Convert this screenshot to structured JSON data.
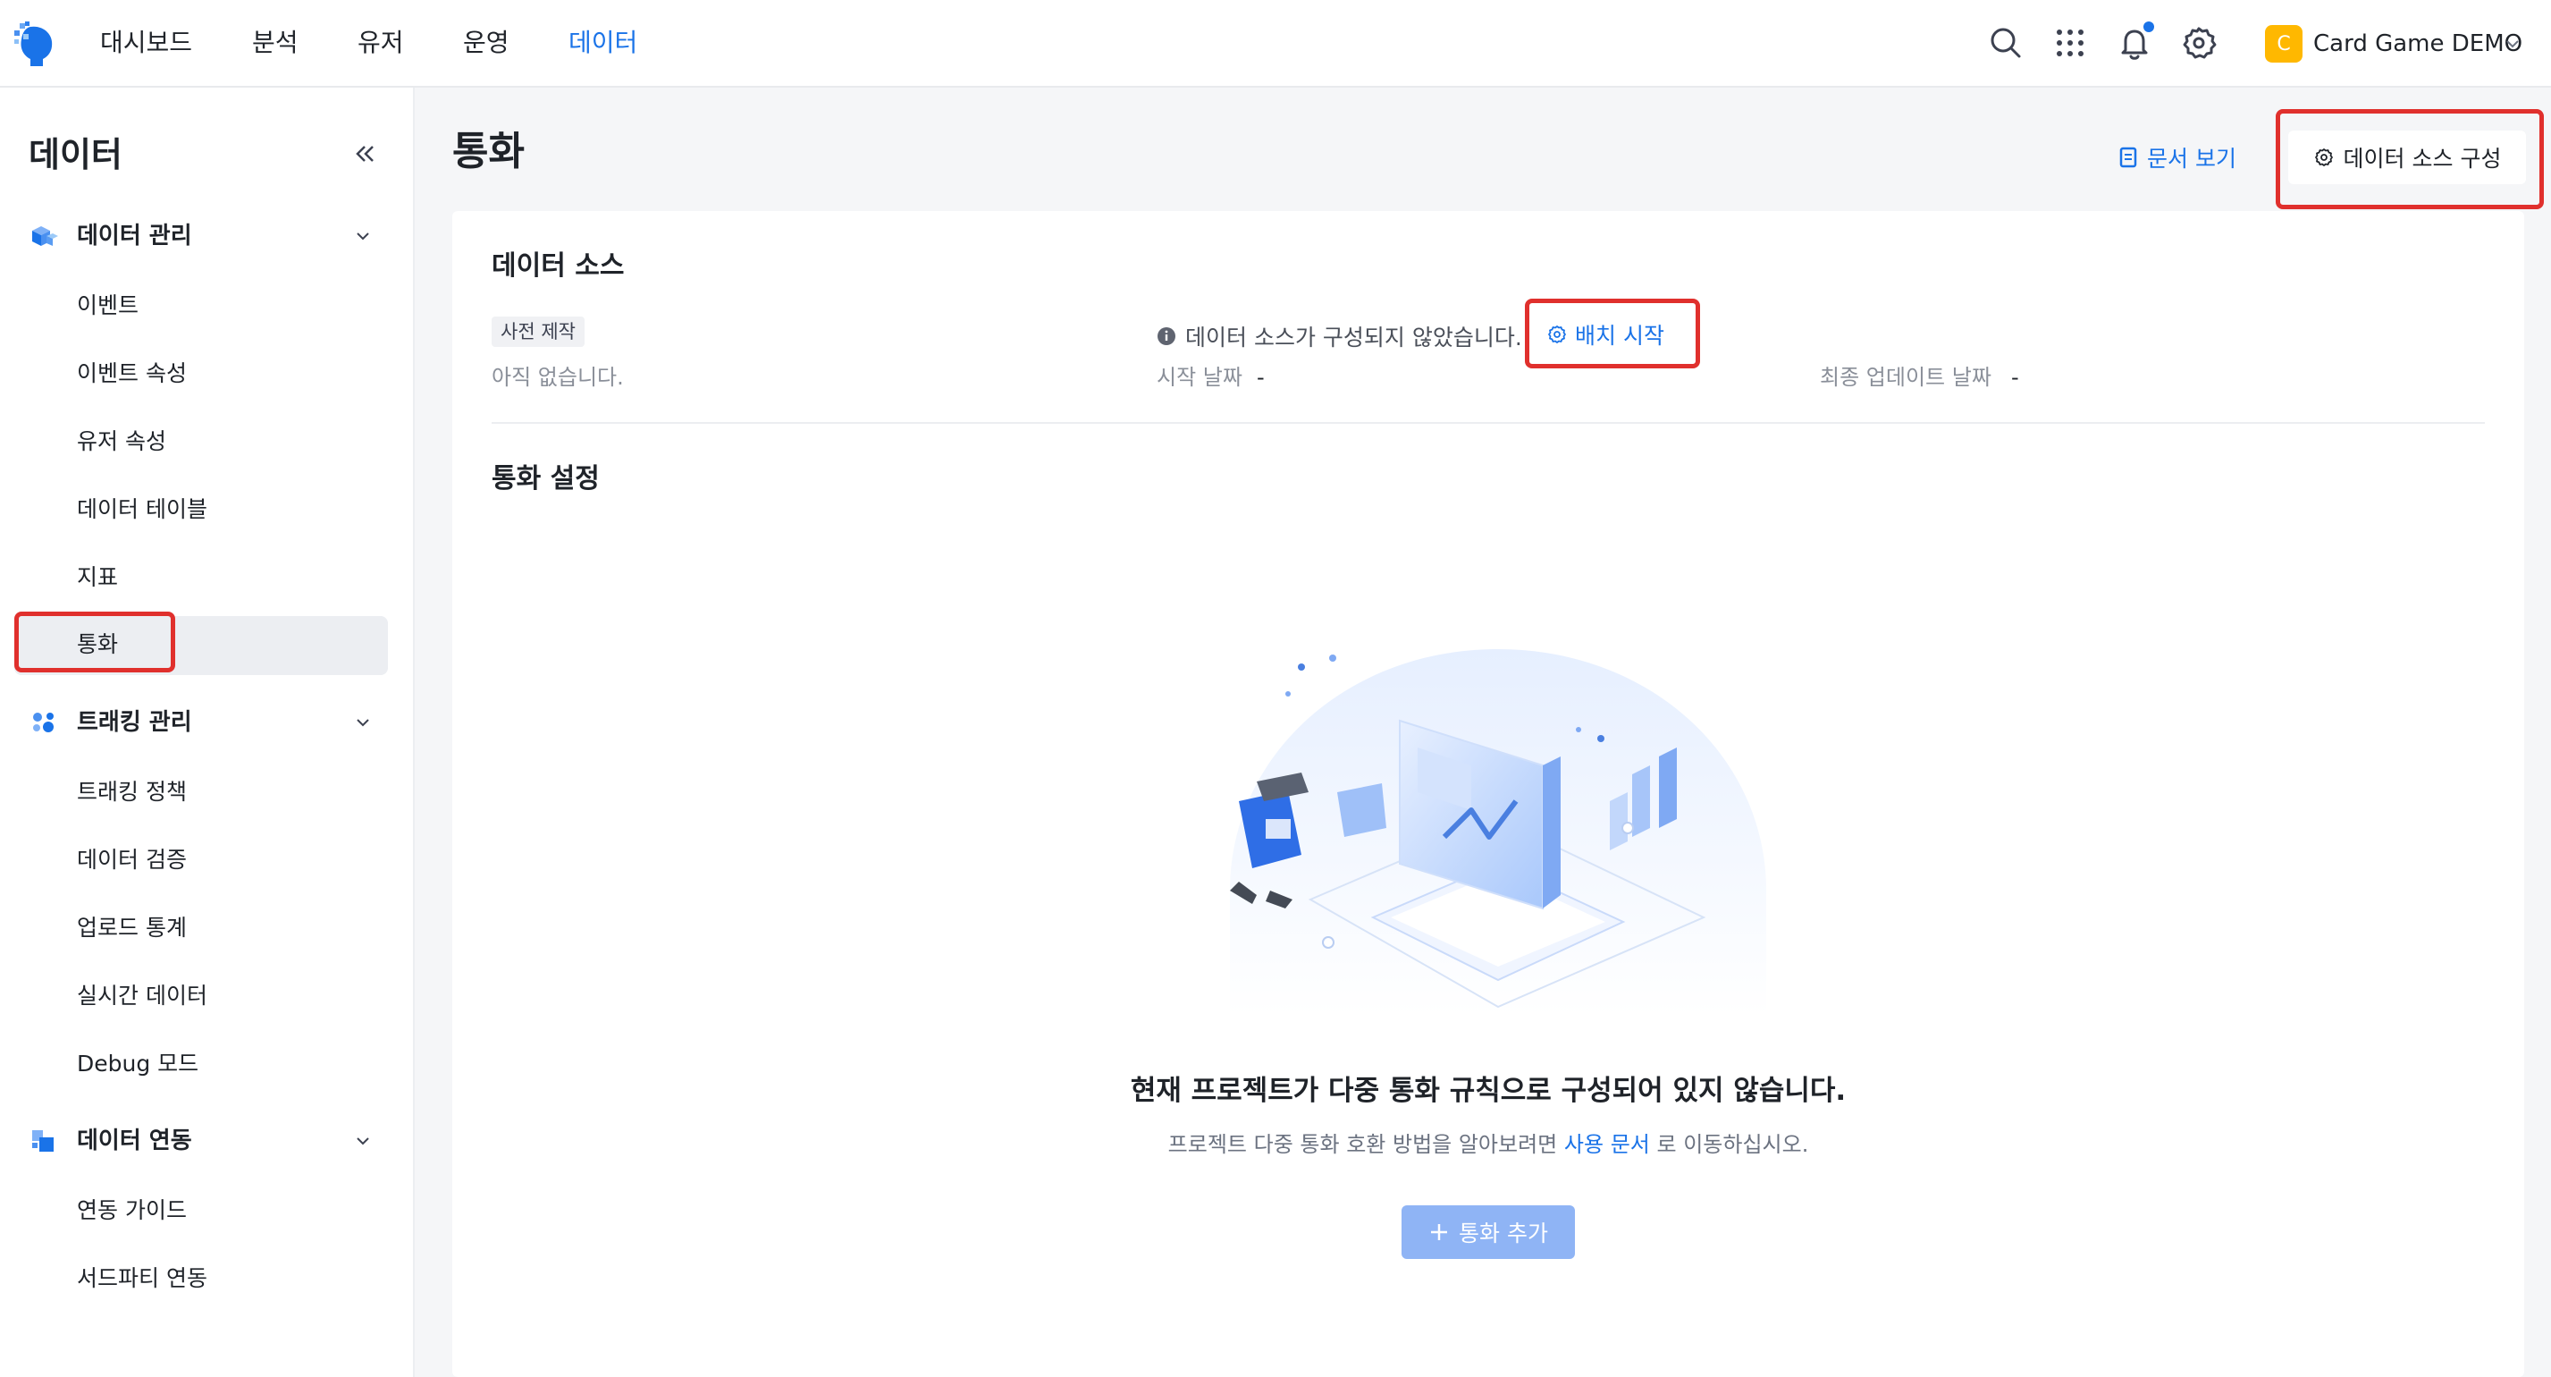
{
  "topnav": {
    "items": [
      {
        "label": "대시보드"
      },
      {
        "label": "분석"
      },
      {
        "label": "유저"
      },
      {
        "label": "운영"
      },
      {
        "label": "데이터"
      }
    ],
    "active_item": "데이터",
    "icons": [
      "search-icon",
      "apps-grid-icon",
      "bell-icon",
      "settings-gear-icon"
    ],
    "project": {
      "badge": "C",
      "name": "Card Game DEMO"
    }
  },
  "sidebar": {
    "title": "데이터",
    "groups": [
      {
        "label": "데이터 관리",
        "icon": "cube-data-icon",
        "items": [
          "이벤트",
          "이벤트 속성",
          "유저 속성",
          "데이터 테이블",
          "지표",
          "통화"
        ]
      },
      {
        "label": "트래킹 관리",
        "icon": "tracking-dots-icon",
        "items": [
          "트래킹 정책",
          "데이터 검증",
          "업로드 통계",
          "실시간 데이터",
          "Debug 모드"
        ]
      },
      {
        "label": "데이터 연동",
        "icon": "integration-blocks-icon",
        "items": [
          "연동 가이드",
          "서드파티 연동"
        ]
      }
    ],
    "active_item": "통화"
  },
  "page": {
    "title": "통화",
    "doc_link": "문서 보기",
    "config_button": "데이터 소스 구성"
  },
  "data_source": {
    "title": "데이터 소스",
    "tag": "사전 제작",
    "empty_text": "아직 없습니다.",
    "info_text": "데이터 소스가 구성되지 않았습니다.",
    "batch_button": "배치 시작",
    "start_date_label": "시작 날짜",
    "start_date_value": "-",
    "last_update_label": "최종 업데이트 날짜",
    "last_update_value": "-"
  },
  "currency_settings": {
    "title": "통화 설정",
    "empty_title": "현재 프로젝트가 다중 통화 규칙으로 구성되어 있지 않습니다.",
    "empty_desc_before": "프로젝트 다중 통화 호환 방법을 알아보려면",
    "empty_desc_link": "사용 문서",
    "empty_desc_after": "로 이동하십시오.",
    "add_button": "통화 추가"
  },
  "colors": {
    "accent": "#1a73e8",
    "highlight": "#e0302d",
    "project_badge": "#ffb800",
    "disabled_button": "#8fb4f5"
  }
}
